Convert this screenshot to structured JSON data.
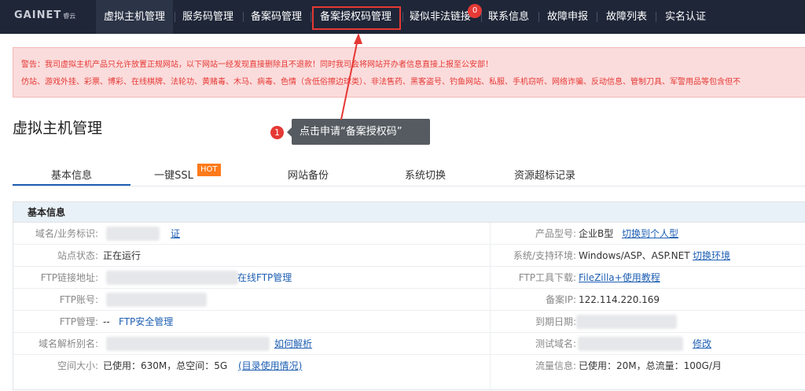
{
  "logo": {
    "text": "GAINET",
    "sub": "睿云"
  },
  "nav": {
    "items": [
      "虚拟主机管理",
      "服务码管理",
      "备案码管理",
      "备案授权码管理",
      "疑似非法链接",
      "联系信息",
      "故障申报",
      "故障列表",
      "实名认证"
    ],
    "badge_count": "0"
  },
  "warning": {
    "line1": "警告：我司虚拟主机产品只允许放置正规网站，以下网站一经发现直接删除且不退款！同时我司会将网站开办者信息直接上报至公安部！",
    "line2": "仿站、游戏外挂、彩票、博彩、在线棋牌、法轮功、黄赌毒、木马、病毒、色情（含低俗擦边球类）、非法售药、黑客盗号、钓鱼网站、私服、手机窃听、网络诈骗、反动信息、管制刀具、军警用品等包含但不"
  },
  "page_title": "虚拟主机管理",
  "callout": {
    "number": "1",
    "text": "点击申请“备案授权码”"
  },
  "tabs": {
    "items": [
      "基本信息",
      "一键SSL",
      "网站备份",
      "系统切换",
      "资源超标记录"
    ],
    "hot": "HOT"
  },
  "section": {
    "title": "基本信息",
    "left": [
      {
        "label": "域名/业务标识:",
        "value": "",
        "link": "证"
      },
      {
        "label": "站点状态:",
        "value": "正在运行",
        "link": ""
      },
      {
        "label": "FTP链接地址:",
        "value": "",
        "link": "在线FTP管理"
      },
      {
        "label": "FTP账号:",
        "value": "",
        "link": ""
      },
      {
        "label": "FTP管理:",
        "value": "--",
        "link": "FTP安全管理"
      },
      {
        "label": "域名解析别名:",
        "value": "",
        "link": "如何解析"
      },
      {
        "label": "空间大小:",
        "value": "已使用：630M，总空间：5G",
        "link": "(目录使用情况)"
      }
    ],
    "right": [
      {
        "label": "产品型号:",
        "value": "企业B型",
        "link": "切换到个人型"
      },
      {
        "label": "系统/支持环境:",
        "value": "Windows/ASP、ASP.NET",
        "link": "切换环境"
      },
      {
        "label": "FTP工具下载:",
        "value": "",
        "link": "FileZilla+使用教程"
      },
      {
        "label": "备案IP:",
        "value": "122.114.220.169",
        "link": ""
      },
      {
        "label": "到期日期:",
        "value": "",
        "link": ""
      },
      {
        "label": "测试域名:",
        "value": "",
        "link": "修改"
      },
      {
        "label": "流量信息:",
        "value": "已使用：20M，总流量：100G/月",
        "link": ""
      }
    ]
  }
}
